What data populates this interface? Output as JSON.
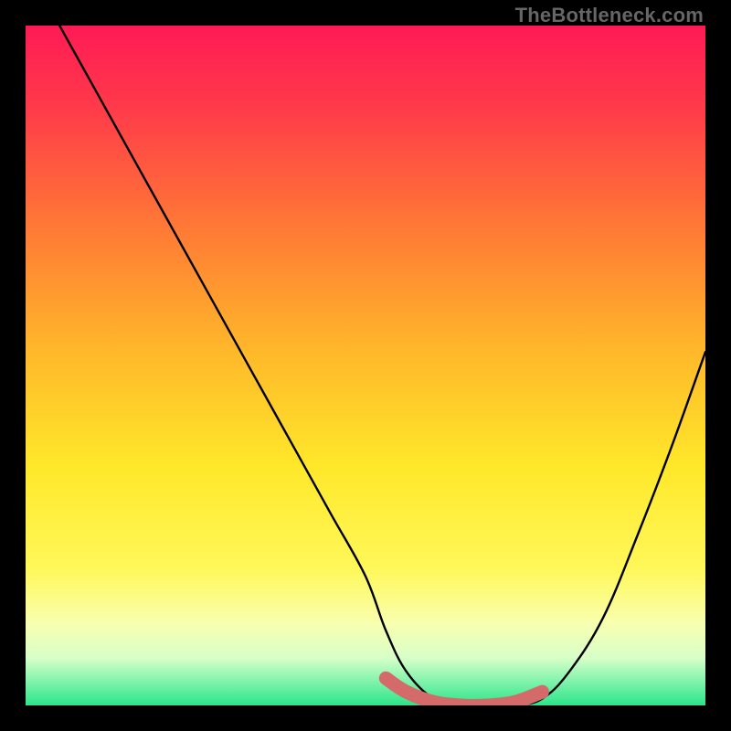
{
  "watermark": "TheBottleneck.com",
  "colors": {
    "bg": "#000000",
    "grad_top": "#ff1a55",
    "grad_mid1": "#ff8a2a",
    "grad_mid2": "#ffe82a",
    "grad_low": "#fbffb0",
    "grad_bottom": "#2be58a",
    "curve": "#000000",
    "marker": "#d56a6a",
    "watermark": "#666666"
  },
  "chart_data": {
    "type": "line",
    "title": "",
    "xlabel": "",
    "ylabel": "",
    "xlim": [
      0,
      100
    ],
    "ylim": [
      0,
      100
    ],
    "series": [
      {
        "name": "bottleneck-curve",
        "x": [
          5,
          10,
          15,
          20,
          25,
          30,
          35,
          40,
          45,
          50,
          53,
          56,
          60,
          64,
          68,
          72,
          76,
          80,
          85,
          90,
          95,
          100
        ],
        "y": [
          100,
          91,
          82,
          73,
          64,
          55,
          46,
          37,
          28,
          19,
          11,
          5,
          1,
          0,
          0,
          0,
          1,
          5,
          13,
          25,
          38,
          52
        ]
      }
    ],
    "markers": {
      "name": "highlight-band",
      "x": [
        53,
        56,
        60,
        64,
        68,
        72,
        76
      ],
      "y": [
        4,
        2,
        0.5,
        0,
        0,
        0.5,
        2
      ]
    }
  }
}
